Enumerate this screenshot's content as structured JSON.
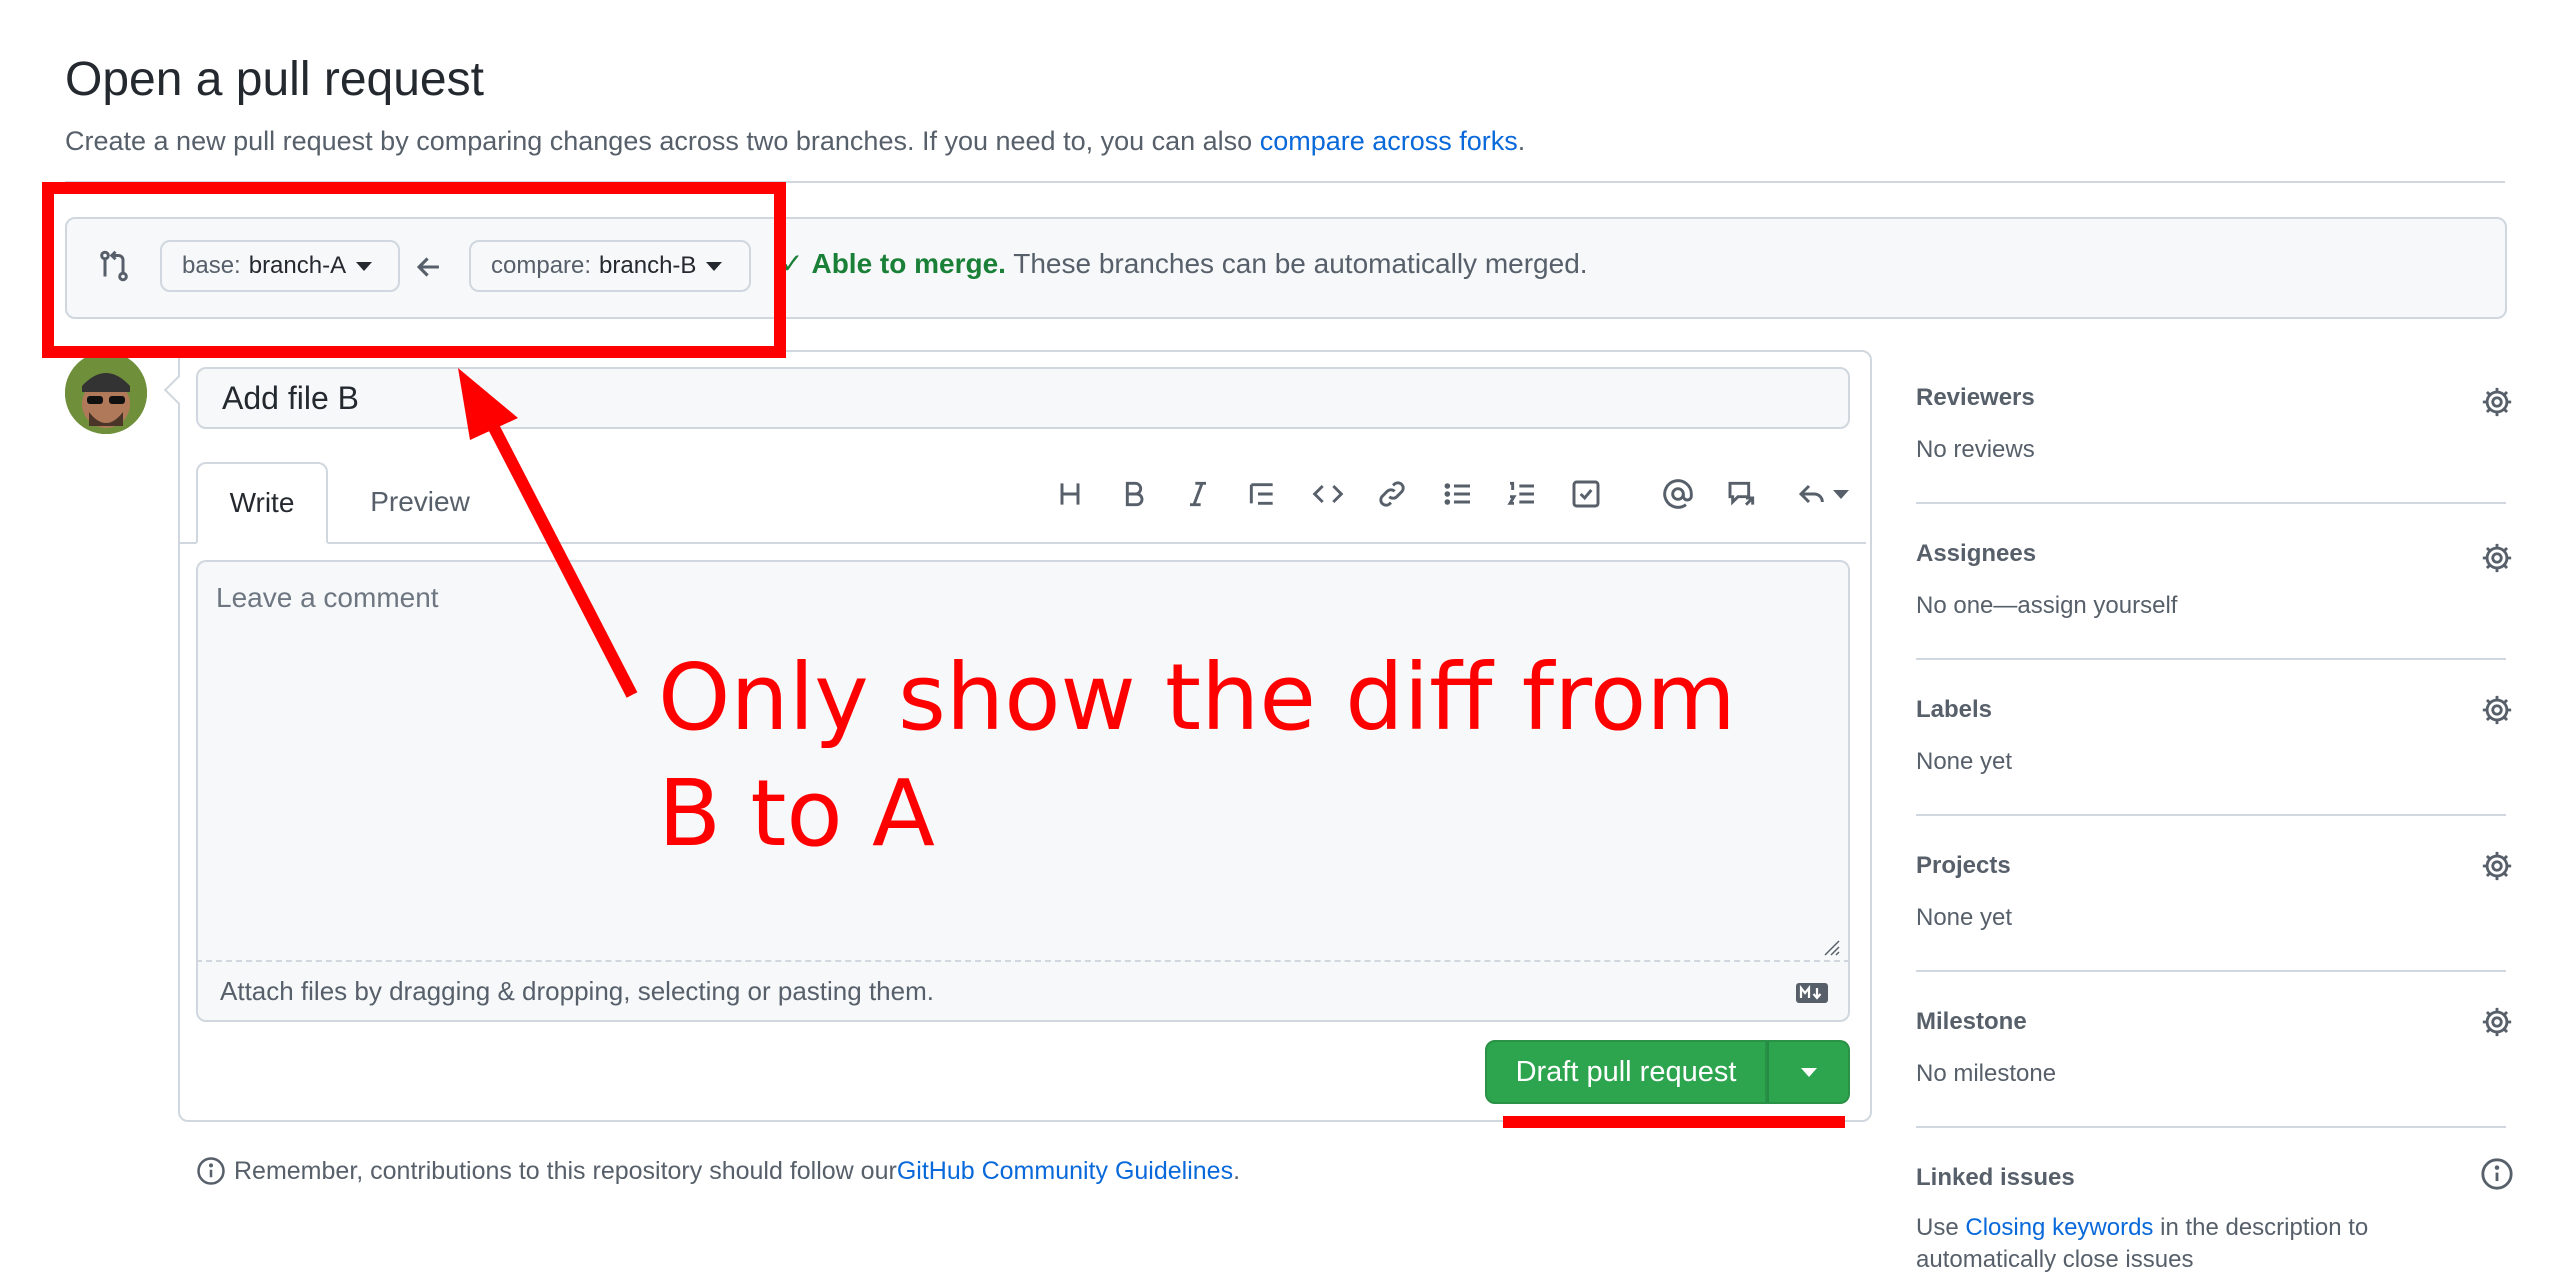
{
  "header": {
    "title": "Open a pull request",
    "subtitle_prefix": "Create a new pull request by comparing changes across two branches. If you need to, you can also ",
    "subtitle_link": "compare across forks",
    "subtitle_suffix": "."
  },
  "compare": {
    "base_prefix": "base:",
    "base_branch": "branch-A",
    "compare_prefix": "compare:",
    "compare_branch": "branch-B",
    "merge_check": "✓",
    "merge_status": "Able to merge.",
    "merge_detail": "These branches can be automatically merged."
  },
  "form": {
    "title_value": "Add file B",
    "tab_write": "Write",
    "tab_preview": "Preview",
    "comment_placeholder": "Leave a comment",
    "attach_text": "Attach files by dragging & dropping, selecting or pasting them.",
    "submit_label": "Draft pull request",
    "toolbar": [
      "heading-icon",
      "bold-icon",
      "italic-icon",
      "quote-icon",
      "code-icon",
      "link-icon",
      "bullet-list-icon",
      "numbered-list-icon",
      "task-list-icon",
      "mention-icon",
      "reference-icon",
      "reply-icon"
    ]
  },
  "guidelines": {
    "prefix": "Remember, contributions to this repository should follow our ",
    "link": "GitHub Community Guidelines",
    "suffix": "."
  },
  "sidebar": {
    "reviewers": {
      "heading": "Reviewers",
      "value": "No reviews"
    },
    "assignees": {
      "heading": "Assignees",
      "value": "No one—assign yourself"
    },
    "labels": {
      "heading": "Labels",
      "value": "None yet"
    },
    "projects": {
      "heading": "Projects",
      "value": "None yet"
    },
    "milestone": {
      "heading": "Milestone",
      "value": "No milestone"
    },
    "linked_issues": {
      "heading": "Linked issues",
      "value_prefix": "Use ",
      "value_link": "Closing keywords",
      "value_suffix": " in the description to",
      "value_line2": "automatically close issues"
    }
  },
  "annotation": {
    "text_line1": "Only show the diff from",
    "text_line2": "B to A",
    "color": "#ff0000"
  },
  "colors": {
    "accent": "#0969da",
    "success": "#1a7f37",
    "primary_button": "#2da44e"
  }
}
